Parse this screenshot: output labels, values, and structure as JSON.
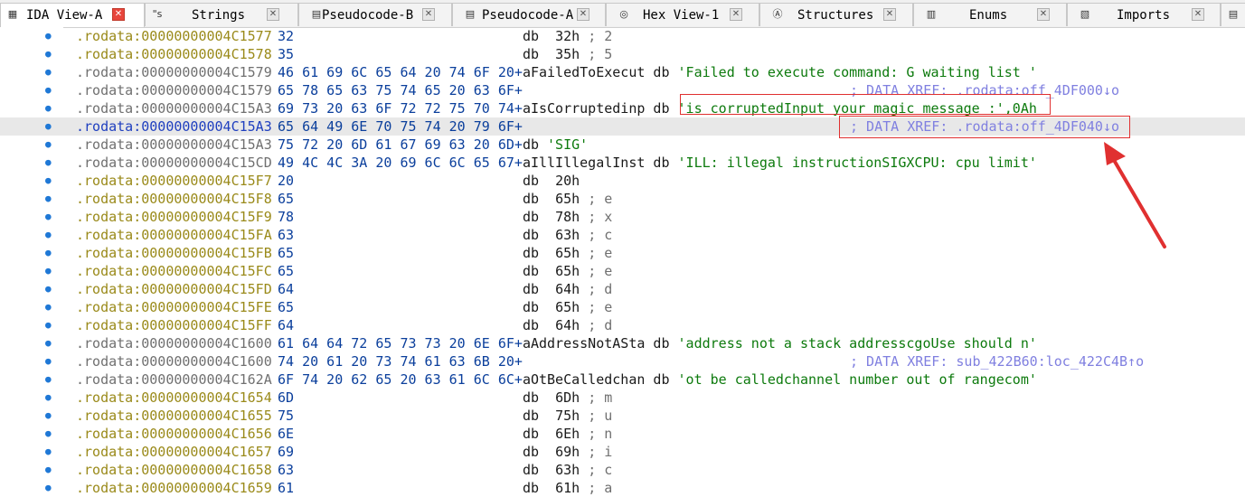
{
  "tabs": [
    {
      "label": "IDA View-A",
      "icon": "graph-view-icon",
      "active": true
    },
    {
      "label": "Strings",
      "icon": "strings-icon",
      "active": false
    },
    {
      "label": "Pseudocode-B",
      "icon": "pseudocode-icon",
      "active": false
    },
    {
      "label": "Pseudocode-A",
      "icon": "pseudocode-icon",
      "active": false
    },
    {
      "label": "Hex View-1",
      "icon": "hex-view-icon",
      "active": false
    },
    {
      "label": "Structures",
      "icon": "structures-icon",
      "active": false
    },
    {
      "label": "Enums",
      "icon": "enums-icon",
      "active": false
    },
    {
      "label": "Imports",
      "icon": "imports-icon",
      "active": false
    }
  ],
  "rows": [
    {
      "addr": ".rodata:00000000004C1577",
      "hex": "32",
      "rest": "db  32h ; 2"
    },
    {
      "addr": ".rodata:00000000004C1578",
      "hex": "35",
      "rest": "db  35h ; 5"
    },
    {
      "addr": ".rodata:00000000004C1579",
      "hex": "46 61 69 6C 65 64 20 74 6F 20+aFailedToExecut db 'Failed to execute command: G waiting list '"
    },
    {
      "addr": ".rodata:00000000004C1579",
      "hex": "65 78 65 63 75 74 65 20 63 6F+",
      "xref": "; DATA XREF: .rodata:off_4DF000↓o"
    },
    {
      "addr": ".rodata:00000000004C15A3",
      "hex": "69 73 20 63 6F 72 72 75 70 74+aIsCorruptedinp db 'is corruptedInput your magic message :',0Ah"
    },
    {
      "addr": ".rodata:00000000004C15A3",
      "hex": "65 64 49 6E 70 75 74 20 79 6F+",
      "xref": "; DATA XREF: .rodata:off_4DF040↓o"
    },
    {
      "addr": ".rodata:00000000004C15A3",
      "hex": "75 72 20 6D 61 67 69 63 20 6D+db 'SIG'"
    },
    {
      "addr": ".rodata:00000000004C15CD",
      "hex": "49 4C 4C 3A 20 69 6C 6C 65 67+aIllIllegalInst db 'ILL: illegal instructionSIGXCPU: cpu limit'"
    },
    {
      "addr": ".rodata:00000000004C15F7",
      "hex": "20",
      "rest": "db  20h"
    },
    {
      "addr": ".rodata:00000000004C15F8",
      "hex": "65",
      "rest": "db  65h ; e"
    },
    {
      "addr": ".rodata:00000000004C15F9",
      "hex": "78",
      "rest": "db  78h ; x"
    },
    {
      "addr": ".rodata:00000000004C15FA",
      "hex": "63",
      "rest": "db  63h ; c"
    },
    {
      "addr": ".rodata:00000000004C15FB",
      "hex": "65",
      "rest": "db  65h ; e"
    },
    {
      "addr": ".rodata:00000000004C15FC",
      "hex": "65",
      "rest": "db  65h ; e"
    },
    {
      "addr": ".rodata:00000000004C15FD",
      "hex": "64",
      "rest": "db  64h ; d"
    },
    {
      "addr": ".rodata:00000000004C15FE",
      "hex": "65",
      "rest": "db  65h ; e"
    },
    {
      "addr": ".rodata:00000000004C15FF",
      "hex": "64",
      "rest": "db  64h ; d"
    },
    {
      "addr": ".rodata:00000000004C1600",
      "hex": "61 64 64 72 65 73 73 20 6E 6F+aAddressNotASta db 'address not a stack addresscgoUse should n'"
    },
    {
      "addr": ".rodata:00000000004C1600",
      "hex": "74 20 61 20 73 74 61 63 6B 20+",
      "xref": "; DATA XREF: sub_422B60:loc_422C4B↑o"
    },
    {
      "addr": ".rodata:00000000004C162A",
      "hex": "6F 74 20 62 65 20 63 61 6C 6C+aOtBeCalledchan db 'ot be calledchannel number out of rangecom'"
    },
    {
      "addr": ".rodata:00000000004C1654",
      "hex": "6D",
      "rest": "db  6Dh ; m"
    },
    {
      "addr": ".rodata:00000000004C1655",
      "hex": "75",
      "rest": "db  75h ; u"
    },
    {
      "addr": ".rodata:00000000004C1656",
      "hex": "6E",
      "rest": "db  6Eh ; n"
    },
    {
      "addr": ".rodata:00000000004C1657",
      "hex": "69",
      "rest": "db  69h ; i"
    },
    {
      "addr": ".rodata:00000000004C1658",
      "hex": "63",
      "rest": "db  63h ; c"
    },
    {
      "addr": ".rodata:00000000004C1659",
      "hex": "61",
      "rest": "db  61h ; a"
    }
  ],
  "colors": {
    "address_gray": "#707070",
    "address_yellow": "#9a8a1a",
    "address_selected": "#1f3fbf",
    "hex_bytes": "#0b3f9c",
    "string_green": "#0d7a0d",
    "xref_comment": "#8080e0",
    "annotation_red": "#e03030",
    "highlight_row": "#e8e8e8"
  }
}
